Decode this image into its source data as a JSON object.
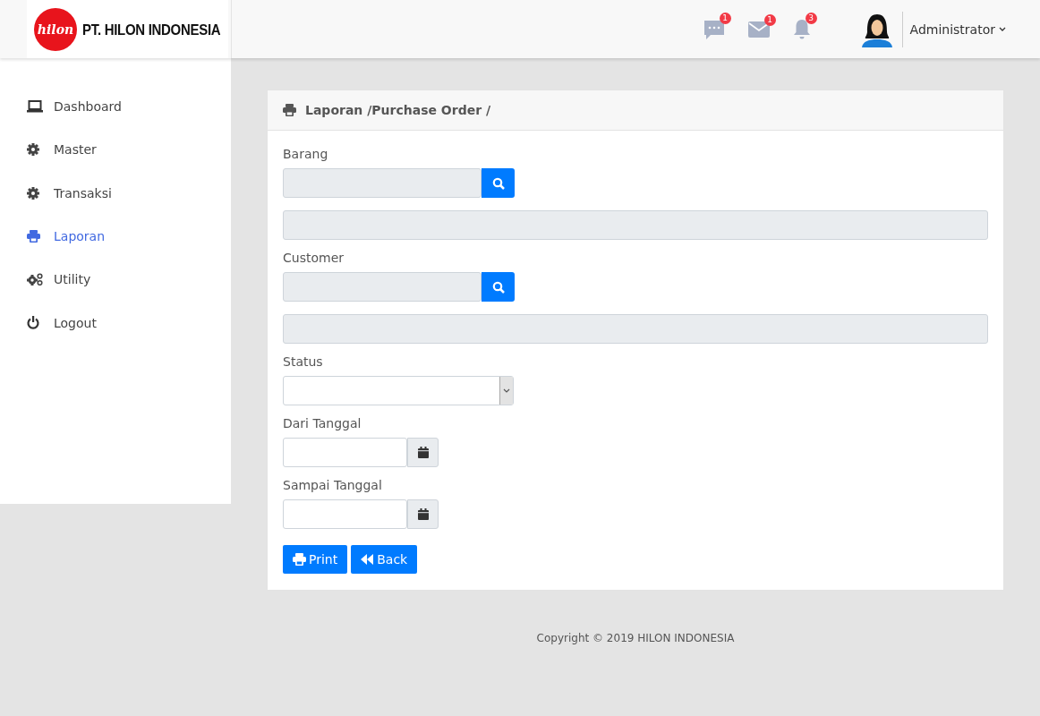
{
  "header": {
    "logo_mark": "hilon",
    "company": "PT. HILON INDONESIA",
    "notifications": [
      {
        "kind": "chat",
        "count": "1"
      },
      {
        "kind": "mail",
        "count": "1"
      },
      {
        "kind": "bell",
        "count": "3"
      }
    ],
    "user": {
      "name": "Administrator"
    }
  },
  "sidebar": {
    "items": [
      {
        "label": "Dashboard",
        "kind": "laptop",
        "selected": false
      },
      {
        "label": "Master",
        "kind": "gear",
        "selected": false
      },
      {
        "label": "Transaksi",
        "kind": "gear",
        "selected": false
      },
      {
        "label": "Laporan",
        "kind": "print",
        "selected": true
      },
      {
        "label": "Utility",
        "kind": "gears",
        "selected": false
      },
      {
        "label": "Logout",
        "kind": "power",
        "selected": false
      }
    ]
  },
  "panel": {
    "title": "Laporan /Purchase Order /",
    "fields": [
      {
        "kind": "lookup",
        "label": "Barang"
      },
      {
        "kind": "lookup",
        "label": "Customer"
      },
      {
        "kind": "select",
        "label": "Status"
      },
      {
        "kind": "date",
        "label": "Dari Tanggal"
      },
      {
        "kind": "date",
        "label": "Sampai Tanggal"
      }
    ],
    "buttons": [
      {
        "label": "Print",
        "kind": "print"
      },
      {
        "label": "Back",
        "kind": "backward"
      }
    ]
  },
  "footer": "Copyright © 2019 HILON INDONESIA"
}
